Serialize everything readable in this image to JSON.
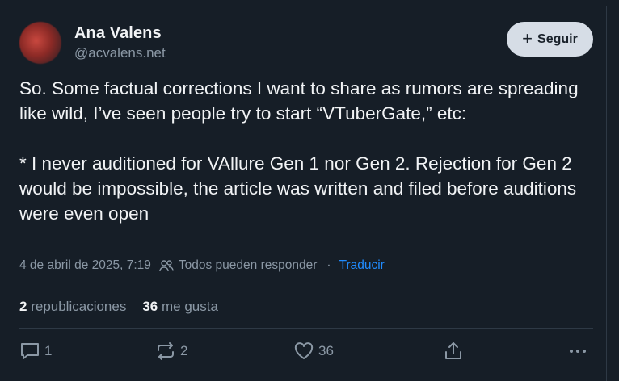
{
  "author": {
    "display_name": "Ana Valens",
    "handle": "@acvalens.net"
  },
  "follow_button": {
    "icon": "plus-icon",
    "label": "Seguir"
  },
  "post": {
    "text": "So. Some factual corrections I want to share as rumors are spreading like wild, I’ve seen people try to start “VTuberGate,” etc:\n\n* I never auditioned for VAllure Gen 1 nor Gen 2. Rejection for Gen 2 would be impossible, the article was written and filed before auditions were even open"
  },
  "meta": {
    "timestamp": "4 de abril de 2025, 7:19",
    "reply_setting": "Todos pueden responder",
    "separator": "·",
    "translate_label": "Traducir"
  },
  "stats": {
    "reposts_count": "2",
    "reposts_label": "republicaciones",
    "likes_count": "36",
    "likes_label": "me gusta"
  },
  "actions": {
    "reply_count": "1",
    "repost_count": "2",
    "like_count": "36"
  },
  "colors": {
    "background": "#161e27",
    "text": "#f1f3f5",
    "muted": "#8b98a5",
    "link": "#208bfe",
    "follow_bg": "#d6dde6"
  }
}
